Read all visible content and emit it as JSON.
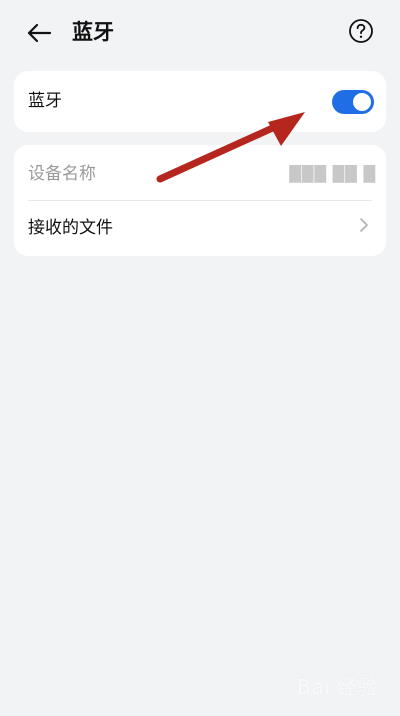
{
  "header": {
    "title": "蓝牙",
    "back_icon": "back-arrow-icon",
    "help_icon": "help-circle-icon"
  },
  "bluetooth": {
    "label": "蓝牙",
    "enabled": true,
    "toggle_color": "#1f6ee6"
  },
  "device": {
    "label": "设备名称",
    "value": "███ ██  █"
  },
  "received_files": {
    "label": "接收的文件",
    "chevron_icon": "chevron-right-icon"
  },
  "watermark": {
    "text": "Bai 经验"
  }
}
